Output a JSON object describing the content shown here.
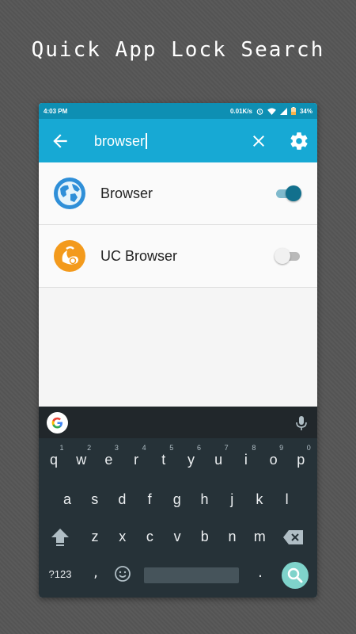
{
  "headline": "Quick App Lock Search",
  "status_bar": {
    "time": "4:03 PM",
    "network_speed": "0.01K/s",
    "battery": "34%"
  },
  "app_bar": {
    "search_query": "browser",
    "back_icon": "arrow-left-icon",
    "clear_icon": "close-icon",
    "settings_icon": "gear-icon"
  },
  "results": [
    {
      "name": "Browser",
      "icon": "globe-icon",
      "locked": true
    },
    {
      "name": "UC Browser",
      "icon": "uc-squirrel-icon",
      "locked": false
    }
  ],
  "keyboard": {
    "row1": [
      {
        "key": "q",
        "hint": "1"
      },
      {
        "key": "w",
        "hint": "2"
      },
      {
        "key": "e",
        "hint": "3"
      },
      {
        "key": "r",
        "hint": "4"
      },
      {
        "key": "t",
        "hint": "5"
      },
      {
        "key": "y",
        "hint": "6"
      },
      {
        "key": "u",
        "hint": "7"
      },
      {
        "key": "i",
        "hint": "8"
      },
      {
        "key": "o",
        "hint": "9"
      },
      {
        "key": "p",
        "hint": "0"
      }
    ],
    "row2": [
      "a",
      "s",
      "d",
      "f",
      "g",
      "h",
      "j",
      "k",
      "l"
    ],
    "row3": [
      "z",
      "x",
      "c",
      "v",
      "b",
      "n",
      "m"
    ],
    "symbols_label": "?123",
    "comma": ",",
    "period": "."
  },
  "colors": {
    "status_bar": "#0e8fb3",
    "app_bar": "#17a9d4",
    "toggle_on": "#12708d",
    "keyboard_bg": "#263238",
    "search_key": "#7fd3cb"
  }
}
